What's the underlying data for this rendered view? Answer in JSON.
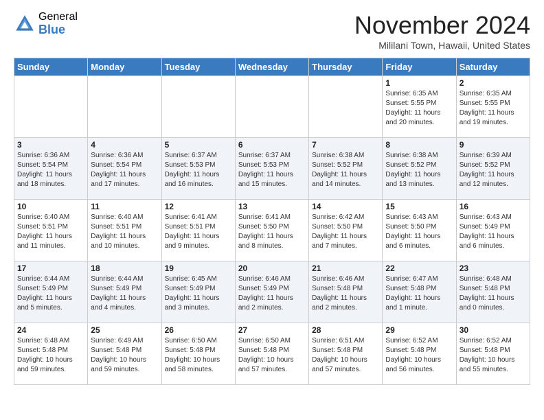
{
  "header": {
    "logo_general": "General",
    "logo_blue": "Blue",
    "month_title": "November 2024",
    "location": "Mililani Town, Hawaii, United States"
  },
  "days_of_week": [
    "Sunday",
    "Monday",
    "Tuesday",
    "Wednesday",
    "Thursday",
    "Friday",
    "Saturday"
  ],
  "weeks": [
    [
      {
        "day": "",
        "info": ""
      },
      {
        "day": "",
        "info": ""
      },
      {
        "day": "",
        "info": ""
      },
      {
        "day": "",
        "info": ""
      },
      {
        "day": "",
        "info": ""
      },
      {
        "day": "1",
        "info": "Sunrise: 6:35 AM\nSunset: 5:55 PM\nDaylight: 11 hours and 20 minutes."
      },
      {
        "day": "2",
        "info": "Sunrise: 6:35 AM\nSunset: 5:55 PM\nDaylight: 11 hours and 19 minutes."
      }
    ],
    [
      {
        "day": "3",
        "info": "Sunrise: 6:36 AM\nSunset: 5:54 PM\nDaylight: 11 hours and 18 minutes."
      },
      {
        "day": "4",
        "info": "Sunrise: 6:36 AM\nSunset: 5:54 PM\nDaylight: 11 hours and 17 minutes."
      },
      {
        "day": "5",
        "info": "Sunrise: 6:37 AM\nSunset: 5:53 PM\nDaylight: 11 hours and 16 minutes."
      },
      {
        "day": "6",
        "info": "Sunrise: 6:37 AM\nSunset: 5:53 PM\nDaylight: 11 hours and 15 minutes."
      },
      {
        "day": "7",
        "info": "Sunrise: 6:38 AM\nSunset: 5:52 PM\nDaylight: 11 hours and 14 minutes."
      },
      {
        "day": "8",
        "info": "Sunrise: 6:38 AM\nSunset: 5:52 PM\nDaylight: 11 hours and 13 minutes."
      },
      {
        "day": "9",
        "info": "Sunrise: 6:39 AM\nSunset: 5:52 PM\nDaylight: 11 hours and 12 minutes."
      }
    ],
    [
      {
        "day": "10",
        "info": "Sunrise: 6:40 AM\nSunset: 5:51 PM\nDaylight: 11 hours and 11 minutes."
      },
      {
        "day": "11",
        "info": "Sunrise: 6:40 AM\nSunset: 5:51 PM\nDaylight: 11 hours and 10 minutes."
      },
      {
        "day": "12",
        "info": "Sunrise: 6:41 AM\nSunset: 5:51 PM\nDaylight: 11 hours and 9 minutes."
      },
      {
        "day": "13",
        "info": "Sunrise: 6:41 AM\nSunset: 5:50 PM\nDaylight: 11 hours and 8 minutes."
      },
      {
        "day": "14",
        "info": "Sunrise: 6:42 AM\nSunset: 5:50 PM\nDaylight: 11 hours and 7 minutes."
      },
      {
        "day": "15",
        "info": "Sunrise: 6:43 AM\nSunset: 5:50 PM\nDaylight: 11 hours and 6 minutes."
      },
      {
        "day": "16",
        "info": "Sunrise: 6:43 AM\nSunset: 5:49 PM\nDaylight: 11 hours and 6 minutes."
      }
    ],
    [
      {
        "day": "17",
        "info": "Sunrise: 6:44 AM\nSunset: 5:49 PM\nDaylight: 11 hours and 5 minutes."
      },
      {
        "day": "18",
        "info": "Sunrise: 6:44 AM\nSunset: 5:49 PM\nDaylight: 11 hours and 4 minutes."
      },
      {
        "day": "19",
        "info": "Sunrise: 6:45 AM\nSunset: 5:49 PM\nDaylight: 11 hours and 3 minutes."
      },
      {
        "day": "20",
        "info": "Sunrise: 6:46 AM\nSunset: 5:49 PM\nDaylight: 11 hours and 2 minutes."
      },
      {
        "day": "21",
        "info": "Sunrise: 6:46 AM\nSunset: 5:48 PM\nDaylight: 11 hours and 2 minutes."
      },
      {
        "day": "22",
        "info": "Sunrise: 6:47 AM\nSunset: 5:48 PM\nDaylight: 11 hours and 1 minute."
      },
      {
        "day": "23",
        "info": "Sunrise: 6:48 AM\nSunset: 5:48 PM\nDaylight: 11 hours and 0 minutes."
      }
    ],
    [
      {
        "day": "24",
        "info": "Sunrise: 6:48 AM\nSunset: 5:48 PM\nDaylight: 10 hours and 59 minutes."
      },
      {
        "day": "25",
        "info": "Sunrise: 6:49 AM\nSunset: 5:48 PM\nDaylight: 10 hours and 59 minutes."
      },
      {
        "day": "26",
        "info": "Sunrise: 6:50 AM\nSunset: 5:48 PM\nDaylight: 10 hours and 58 minutes."
      },
      {
        "day": "27",
        "info": "Sunrise: 6:50 AM\nSunset: 5:48 PM\nDaylight: 10 hours and 57 minutes."
      },
      {
        "day": "28",
        "info": "Sunrise: 6:51 AM\nSunset: 5:48 PM\nDaylight: 10 hours and 57 minutes."
      },
      {
        "day": "29",
        "info": "Sunrise: 6:52 AM\nSunset: 5:48 PM\nDaylight: 10 hours and 56 minutes."
      },
      {
        "day": "30",
        "info": "Sunrise: 6:52 AM\nSunset: 5:48 PM\nDaylight: 10 hours and 55 minutes."
      }
    ]
  ]
}
